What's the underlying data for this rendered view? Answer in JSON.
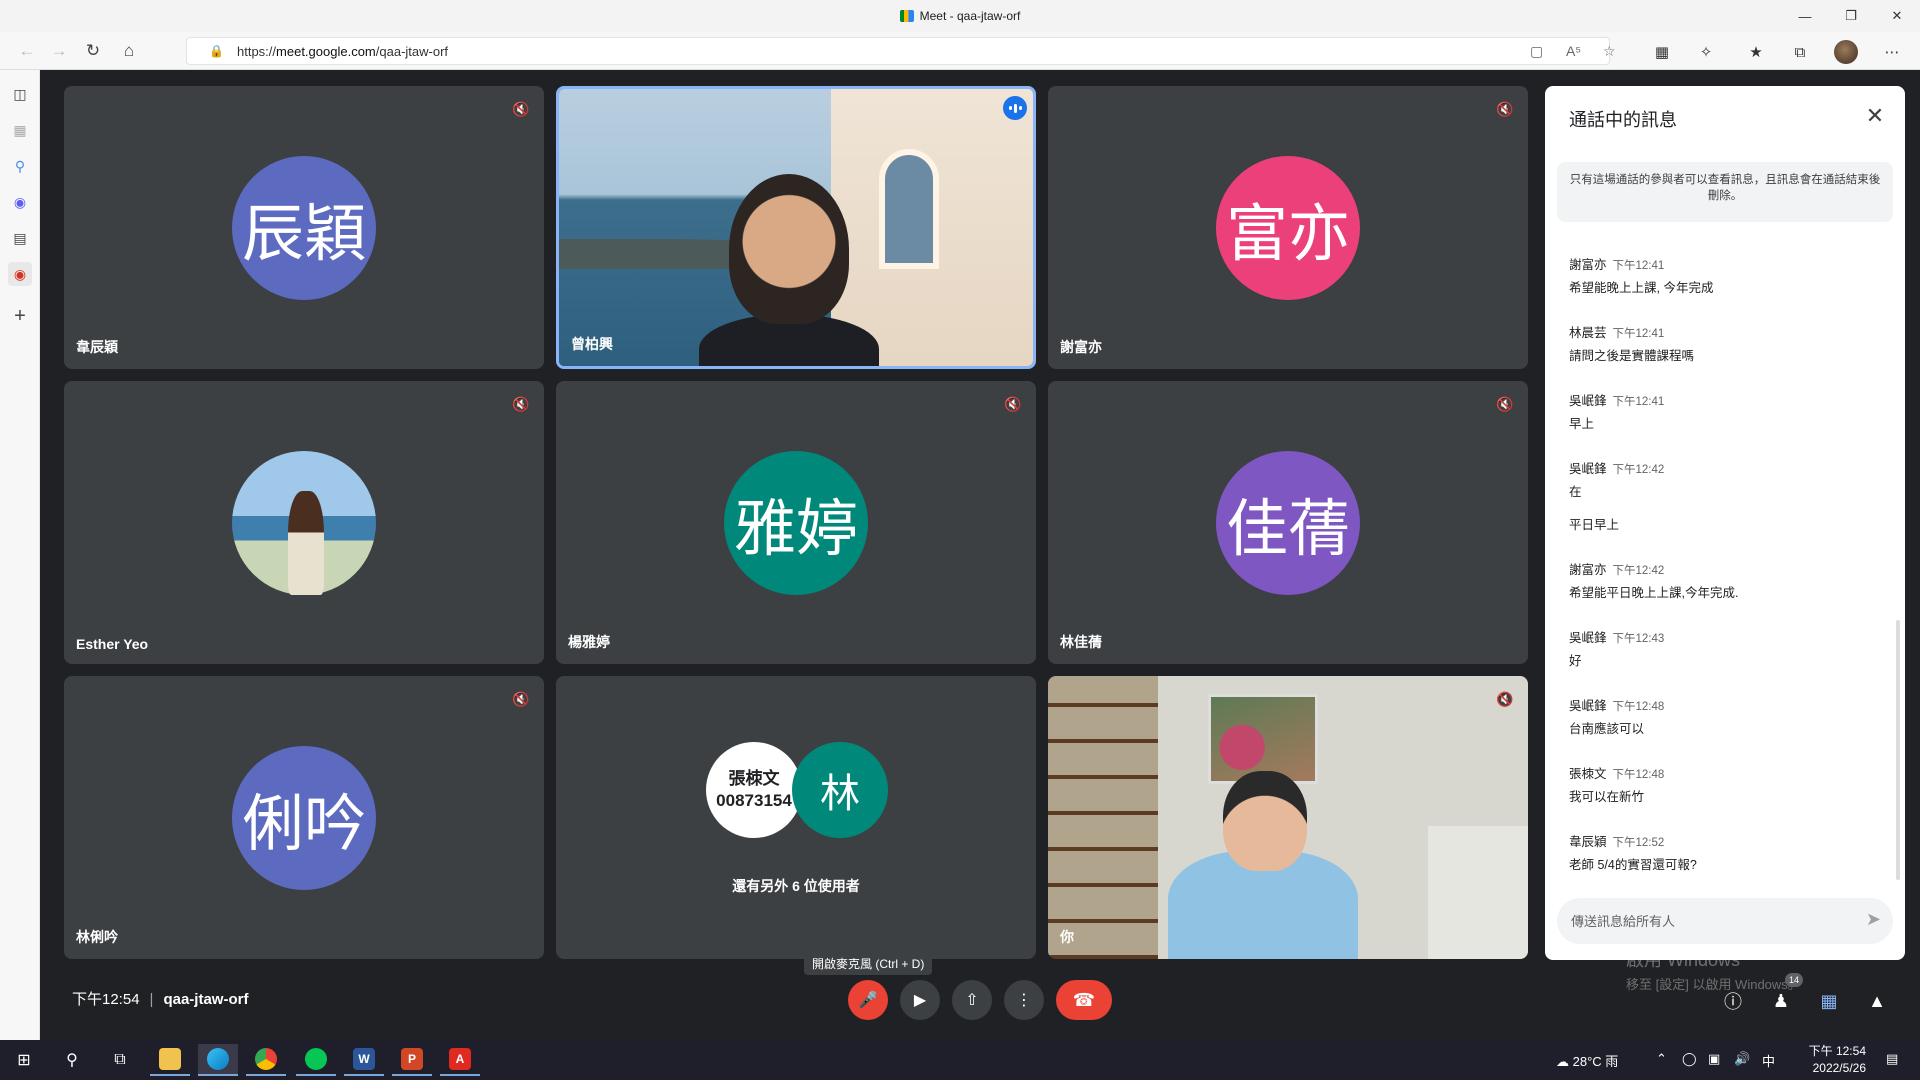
{
  "browser": {
    "window_title": "Meet - qaa-jtaw-orf",
    "url_prefix": "https://",
    "url_host": "meet.google.com",
    "url_path": "/qaa-jtaw-orf"
  },
  "tiles": [
    {
      "name": "韋辰穎",
      "avatar_text": "辰穎",
      "avatar_color": "#5c6bc0"
    },
    {
      "name": "曾柏興",
      "video": true
    },
    {
      "name": "謝富亦",
      "avatar_text": "富亦",
      "avatar_color": "#ec407a"
    },
    {
      "name": "Esther Yeo",
      "photo_avatar": true
    },
    {
      "name": "楊雅婷",
      "avatar_text": "雅婷",
      "avatar_color": "#00897b"
    },
    {
      "name": "林佳蒨",
      "avatar_text": "佳蒨",
      "avatar_color": "#7e57c2"
    },
    {
      "name": "林俐吟",
      "avatar_text": "俐吟",
      "avatar_color": "#5c6bc0"
    },
    {
      "group_avatar1_line1": "張栜文",
      "group_avatar1_line2": "00873154",
      "group_avatar2": "林",
      "group_avatar2_color": "#00897b",
      "others_label": "還有另外 6 位使用者"
    },
    {
      "name": "你",
      "video": true
    }
  ],
  "chat": {
    "title": "通話中的訊息",
    "notice": "只有這場通話的參與者可以查看訊息，且訊息會在通話結束後刪除。",
    "messages": [
      {
        "sender": "謝富亦",
        "time": "下午12:41",
        "text": "希望能晚上上課, 今年完成"
      },
      {
        "sender": "林晨芸",
        "time": "下午12:41",
        "text": "請問之後是實體課程嗎"
      },
      {
        "sender": "吳岷鋒",
        "time": "下午12:41",
        "text": "早上"
      },
      {
        "sender": "吳岷鋒",
        "time": "下午12:42",
        "text": "在",
        "text2": "平日早上"
      },
      {
        "sender": "謝富亦",
        "time": "下午12:42",
        "text": "希望能平日晚上上課,今年完成."
      },
      {
        "sender": "吳岷鋒",
        "time": "下午12:43",
        "text": "好"
      },
      {
        "sender": "吳岷鋒",
        "time": "下午12:48",
        "text": "台南應該可以"
      },
      {
        "sender": "張栜文",
        "time": "下午12:48",
        "text": "我可以在新竹"
      },
      {
        "sender": "韋辰穎",
        "time": "下午12:52",
        "text": "老師 5/4的實習還可報?"
      }
    ],
    "input_placeholder": "傳送訊息給所有人"
  },
  "controls": {
    "time": "下午12:54",
    "separator": "|",
    "meeting_code": "qaa-jtaw-orf",
    "mic_tooltip": "開啟麥克風 (Ctrl + D)",
    "people_count": "14"
  },
  "watermark": {
    "line1": "啟用 Windows",
    "line2": "移至 [設定] 以啟用 Windows。"
  },
  "taskbar": {
    "weather": "28°C  雨",
    "ime": "中",
    "time": "下午 12:54",
    "date": "2022/5/26"
  }
}
